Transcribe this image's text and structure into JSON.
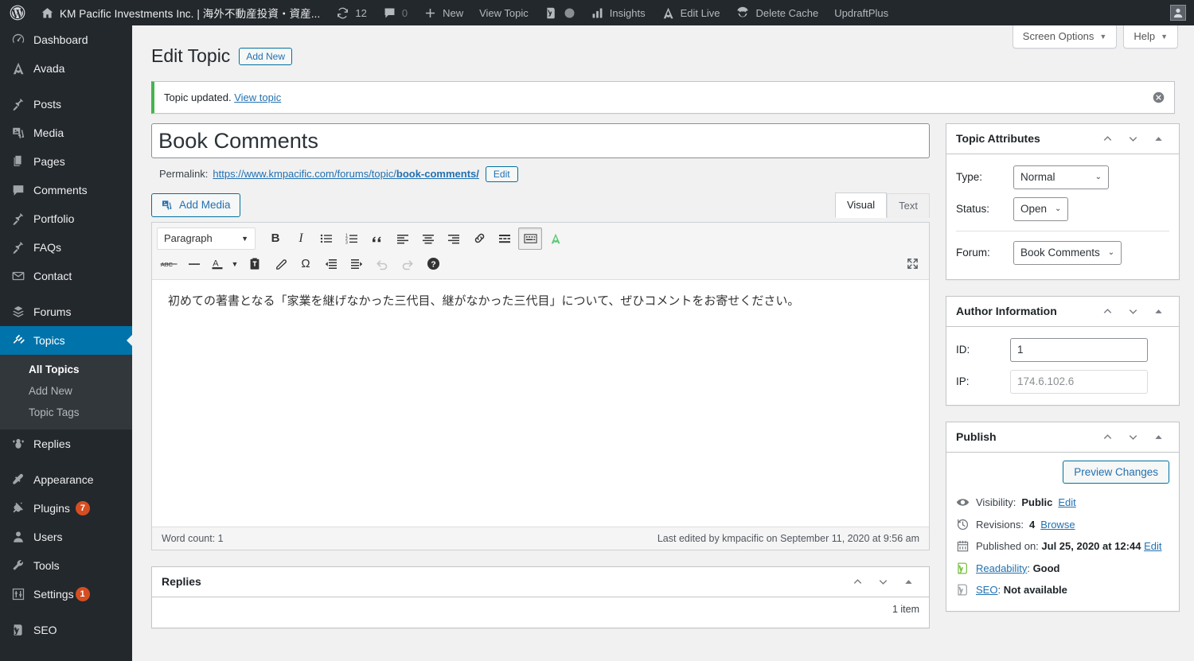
{
  "adminbar": {
    "logo_icon": "wordpress-icon",
    "home_icon": "home-icon",
    "site_name": "KM Pacific Investments Inc. | 海外不動産投資・資産...",
    "updates_icon": "updates-icon",
    "updates_count": "12",
    "comments_icon": "comment-bubble-icon",
    "comments_count": "0",
    "new_icon": "plus-icon",
    "new_label": "New",
    "view_topic_label": "View Topic",
    "yoast_icon": "yoast-icon",
    "circle_icon": "circle-icon",
    "insights_icon": "bar-chart-icon",
    "insights_label": "Insights",
    "edit_live_icon": "avada-icon",
    "edit_live_label": "Edit Live",
    "delete_cache_icon": "wp-rocket-icon",
    "delete_cache_label": "Delete Cache",
    "updraft_label": "UpdraftPlus",
    "avatar_icon": "user-avatar-icon"
  },
  "sidebar": {
    "items": [
      {
        "label": "Dashboard",
        "icon": "dashboard-icon",
        "key": "dashboard"
      },
      {
        "label": "Avada",
        "icon": "avada-icon",
        "key": "avada"
      },
      {
        "label": "Posts",
        "icon": "pin-icon",
        "key": "posts"
      },
      {
        "label": "Media",
        "icon": "media-icon",
        "key": "media"
      },
      {
        "label": "Pages",
        "icon": "pages-icon",
        "key": "pages"
      },
      {
        "label": "Comments",
        "icon": "comment-bubble-icon",
        "key": "comments"
      },
      {
        "label": "Portfolio",
        "icon": "pin-icon",
        "key": "portfolio"
      },
      {
        "label": "FAQs",
        "icon": "pin-icon",
        "key": "faqs"
      },
      {
        "label": "Contact",
        "icon": "envelope-icon",
        "key": "contact"
      },
      {
        "label": "Forums",
        "icon": "forums-icon",
        "key": "forums"
      },
      {
        "label": "Topics",
        "icon": "topics-icon",
        "key": "topics",
        "current": true
      },
      {
        "label": "Replies",
        "icon": "replies-icon",
        "key": "replies"
      },
      {
        "label": "Appearance",
        "icon": "paintbrush-icon",
        "key": "appearance"
      },
      {
        "label": "Plugins",
        "icon": "plug-icon",
        "key": "plugins",
        "badge": "7"
      },
      {
        "label": "Users",
        "icon": "user-icon",
        "key": "users"
      },
      {
        "label": "Tools",
        "icon": "wrench-icon",
        "key": "tools"
      },
      {
        "label": "Settings",
        "icon": "settings-sliders-icon",
        "key": "settings",
        "badge": "1"
      },
      {
        "label": "SEO",
        "icon": "yoast-icon",
        "key": "seo"
      }
    ],
    "submenu": {
      "parent": "Topics",
      "items": [
        {
          "label": "All Topics",
          "current": true
        },
        {
          "label": "Add New",
          "current": false
        },
        {
          "label": "Topic Tags",
          "current": false
        }
      ]
    }
  },
  "screen_meta": {
    "screen_options_label": "Screen Options",
    "help_label": "Help",
    "caret": "▼"
  },
  "page": {
    "title": "Edit Topic",
    "add_new_label": "Add New",
    "notice": {
      "text": "Topic updated.",
      "link_label": "View topic",
      "dismiss_icon": "dismiss-circle-icon"
    }
  },
  "editor": {
    "post_title_value": "Book Comments",
    "permalink_label": "Permalink:",
    "permalink_base": "https://www.kmpacific.com/forums/topic/",
    "permalink_slug": "book-comments/",
    "permalink_edit_label": "Edit",
    "add_media_label": "Add Media",
    "add_media_icon": "media-icon",
    "tabs": [
      {
        "label": "Visual",
        "active": true
      },
      {
        "label": "Text",
        "active": false
      }
    ],
    "format_select": "Paragraph",
    "toolbar_row1": [
      {
        "name": "bold-icon",
        "glyph": "B"
      },
      {
        "name": "italic-icon",
        "glyph": "I"
      },
      {
        "name": "bulleted-list-icon",
        "glyph": ""
      },
      {
        "name": "numbered-list-icon",
        "glyph": ""
      },
      {
        "name": "blockquote-icon",
        "glyph": ""
      },
      {
        "name": "align-left-icon",
        "glyph": ""
      },
      {
        "name": "align-center-icon",
        "glyph": ""
      },
      {
        "name": "align-right-icon",
        "glyph": ""
      },
      {
        "name": "insert-link-icon",
        "glyph": ""
      },
      {
        "name": "read-more-icon",
        "glyph": ""
      },
      {
        "name": "toggle-toolbar-icon",
        "glyph": ""
      },
      {
        "name": "avada-shortcodes-icon",
        "glyph": ""
      }
    ],
    "toolbar_row2": [
      {
        "name": "strikethrough-icon",
        "glyph": "ABC"
      },
      {
        "name": "horizontal-line-icon",
        "glyph": ""
      },
      {
        "name": "text-color-icon",
        "glyph": "A"
      },
      {
        "name": "paste-as-text-icon",
        "glyph": ""
      },
      {
        "name": "clear-formatting-icon",
        "glyph": ""
      },
      {
        "name": "special-character-icon",
        "glyph": "Ω"
      },
      {
        "name": "decrease-indent-icon",
        "glyph": ""
      },
      {
        "name": "increase-indent-icon",
        "glyph": ""
      },
      {
        "name": "undo-icon",
        "glyph": ""
      },
      {
        "name": "redo-icon",
        "glyph": ""
      },
      {
        "name": "keyboard-shortcuts-icon",
        "glyph": "?"
      }
    ],
    "fullscreen_icon": "fullscreen-icon",
    "content": "初めての著書となる「家業を継げなかった三代目、継がなかった三代目」について、ぜひコメントをお寄せください。",
    "word_count": "Word count: 1",
    "last_edited": "Last edited by kmpacific on September 11, 2020 at 9:56 am"
  },
  "topic_attributes": {
    "title": "Topic Attributes",
    "type_label": "Type:",
    "type_value": "Normal",
    "status_label": "Status:",
    "status_value": "Open",
    "forum_label": "Forum:",
    "forum_value": "Book Comments"
  },
  "author_information": {
    "title": "Author Information",
    "id_label": "ID:",
    "id_value": "1",
    "ip_label": "IP:",
    "ip_value": "174.6.102.6"
  },
  "publish": {
    "title": "Publish",
    "preview_label": "Preview Changes",
    "visibility_icon": "eye-icon",
    "visibility_label": "Visibility:",
    "visibility_value": "Public",
    "visibility_edit": "Edit",
    "revisions_icon": "clock-icon",
    "revisions_label": "Revisions:",
    "revisions_count": "4",
    "revisions_browse": "Browse",
    "published_icon": "calendar-icon",
    "published_label": "Published on:",
    "published_value": "Jul 25, 2020 at 12:44",
    "published_edit": "Edit",
    "readability_icon": "yoast-green-icon",
    "readability_label": "Readability",
    "readability_value": "Good",
    "seo_icon": "yoast-grey-icon",
    "seo_label": "SEO",
    "seo_value": "Not available"
  },
  "replies": {
    "title": "Replies",
    "count_label": "1 item"
  },
  "colors": {
    "admin_bar": "#23282d",
    "sidebar": "#23282d",
    "submenu": "#32373c",
    "active_blue": "#0073aa",
    "link_blue": "#2271b1",
    "notice_green": "#46b450",
    "badge_orange": "#d54e21",
    "page_bg": "#f1f1f1",
    "avada_green": "#5ec878"
  }
}
